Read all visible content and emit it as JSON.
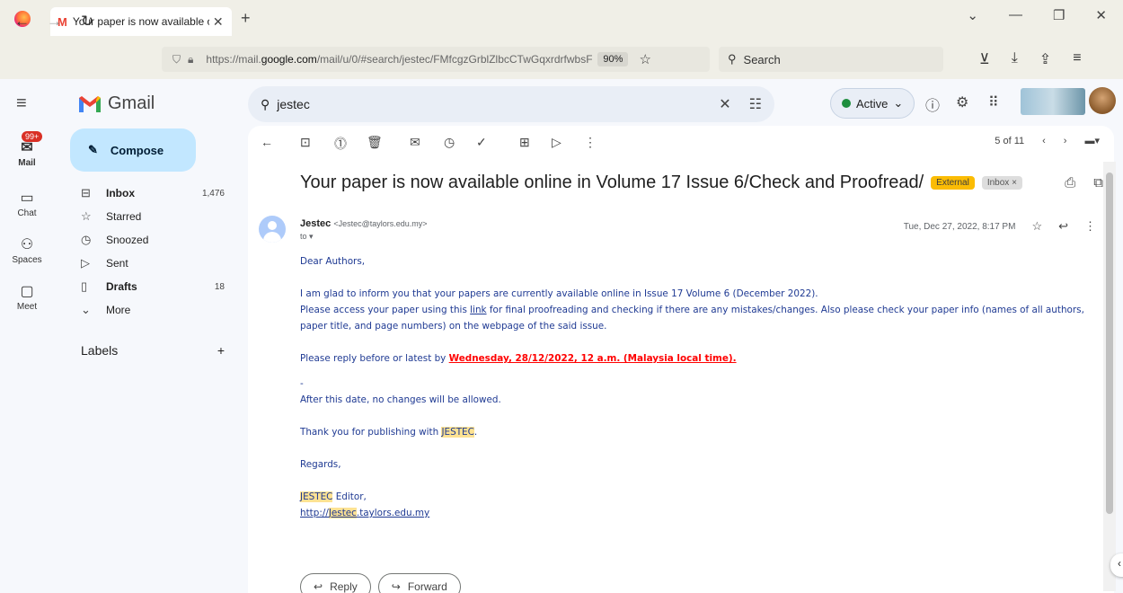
{
  "browser": {
    "tab_title": "Your paper is now available onl",
    "url_pre": "https://mail.",
    "url_domain": "google.com",
    "url_post": "/mail/u/0/#search/jestec/FMfcgzGrblZlbcCTwGqxrdrfwbsF",
    "zoom": "90%",
    "search_placeholder": "Search"
  },
  "gmail": {
    "brand": "Gmail",
    "search_query": "jestec",
    "status": "Active",
    "rail": {
      "mail": "Mail",
      "chat": "Chat",
      "spaces": "Spaces",
      "meet": "Meet",
      "badge": "99+"
    },
    "compose": "Compose",
    "nav": [
      {
        "label": "Inbox",
        "count": "1,476"
      },
      {
        "label": "Starred",
        "count": ""
      },
      {
        "label": "Snoozed",
        "count": ""
      },
      {
        "label": "Sent",
        "count": ""
      },
      {
        "label": "Drafts",
        "count": "18"
      },
      {
        "label": "More",
        "count": ""
      }
    ],
    "labels_title": "Labels"
  },
  "email": {
    "pager": "5 of 11",
    "subject": "Your paper is now available online in Volume 17 Issue 6/Check and Proofread/",
    "chip_external": "External",
    "chip_inbox": "Inbox ×",
    "sender_name": "Jestec",
    "sender_email": "<Jestec@taylors.edu.my>",
    "to": "to ▾",
    "date": "Tue, Dec 27, 2022, 8:17 PM",
    "greeting": "Dear Authors,",
    "p1": "I am glad to inform you that your papers are currently available online in Issue 17 Volume 6 (December 2022).",
    "p2a": "Please access your paper using this ",
    "p2link": "link",
    "p2b": " for final proofreading and checking if there are any mistakes/changes. Also please check your paper info (names of all authors, paper title, and page numbers) on the webpage of the said issue.",
    "p3a": "Please reply before or latest by ",
    "p3red": "Wednesday, 28/12/2022, 12 a.m. (Malaysia local time).",
    "dash": "-",
    "p4": "After this date, no changes will be allowed.",
    "p5a": "Thank you for publishing with ",
    "p5hl": "JESTEC",
    "p5b": ".",
    "regards": "Regards,",
    "sig_hl": "JESTEC",
    "sig_rest": " Editor,",
    "sig_url_a": "http://",
    "sig_url_hl": "Jestec",
    "sig_url_b": ".taylors.edu.my",
    "reply": "Reply",
    "forward": "Forward"
  }
}
